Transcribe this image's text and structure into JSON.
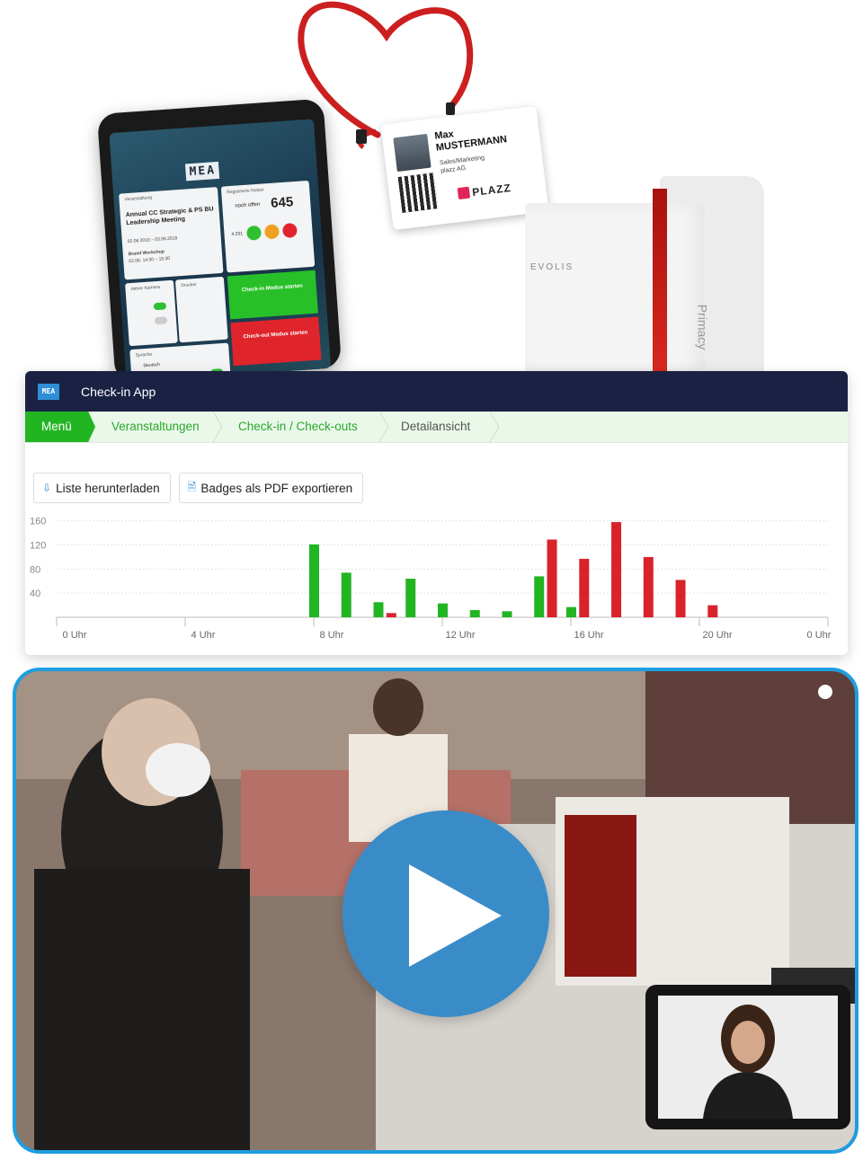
{
  "hero": {
    "tablet": {
      "logo": "MEA",
      "event_label": "Veranstaltung",
      "event_name": "Annual CC Strategic & PS BU Leadership Meeting",
      "event_dates": "02.06.2018 – 03.06.2018",
      "workshop": "Brand Workshop",
      "workshop_time": "02.06. 14:30 – 15:30",
      "registered_label": "Registrierte Nutzer",
      "open_label": "noch offen",
      "open_count": "645",
      "total": "4.231",
      "camera_label": "Aktive Kamera",
      "printer_label": "Drucker",
      "checkin_button": "Check-in Modus starten",
      "checkout_button": "Check-out Modus starten",
      "language_label": "Sprache",
      "language_value": "Deutsch"
    },
    "badge": {
      "first_name": "Max",
      "last_name": "MUSTERMANN",
      "role": "Sales/Marketing",
      "company": "plazz AG",
      "brand": "PLAZZ"
    },
    "printer": {
      "brand": "EVOLIS",
      "model": "Primacy"
    }
  },
  "app": {
    "logo": "MEA",
    "title": "Check-in App",
    "breadcrumbs": [
      "Menü",
      "Veranstaltungen",
      "Check-in / Check-outs",
      "Detailansicht"
    ],
    "buttons": {
      "download_label": "Liste herunterladen",
      "export_label": "Badges als PDF exportieren"
    },
    "colors": {
      "header": "#1b2143",
      "accent_green": "#22b522",
      "checkin": "#22b522",
      "checkout": "#d9232b"
    }
  },
  "chart_data": {
    "type": "bar",
    "ylim": [
      0,
      170
    ],
    "yticks": [
      40,
      80,
      120,
      160
    ],
    "xlim": [
      0,
      24
    ],
    "xticks": [
      "0 Uhr",
      "4 Uhr",
      "8 Uhr",
      "12 Uhr",
      "16 Uhr",
      "20 Uhr",
      "0 Uhr"
    ],
    "grid": true,
    "series": [
      {
        "color": "#22b522",
        "x": [
          8,
          9,
          10,
          11,
          12,
          13,
          14,
          15,
          16
        ],
        "values": [
          121,
          74,
          25,
          64,
          23,
          12,
          10,
          68,
          17
        ]
      },
      {
        "color": "#d9232b",
        "x": [
          10.4,
          15.4,
          16.4,
          17.4,
          18.4,
          19.4,
          20.4
        ],
        "values": [
          7,
          129,
          97,
          158,
          100,
          62,
          20
        ]
      }
    ]
  },
  "video": {
    "play_label": "Play video"
  }
}
